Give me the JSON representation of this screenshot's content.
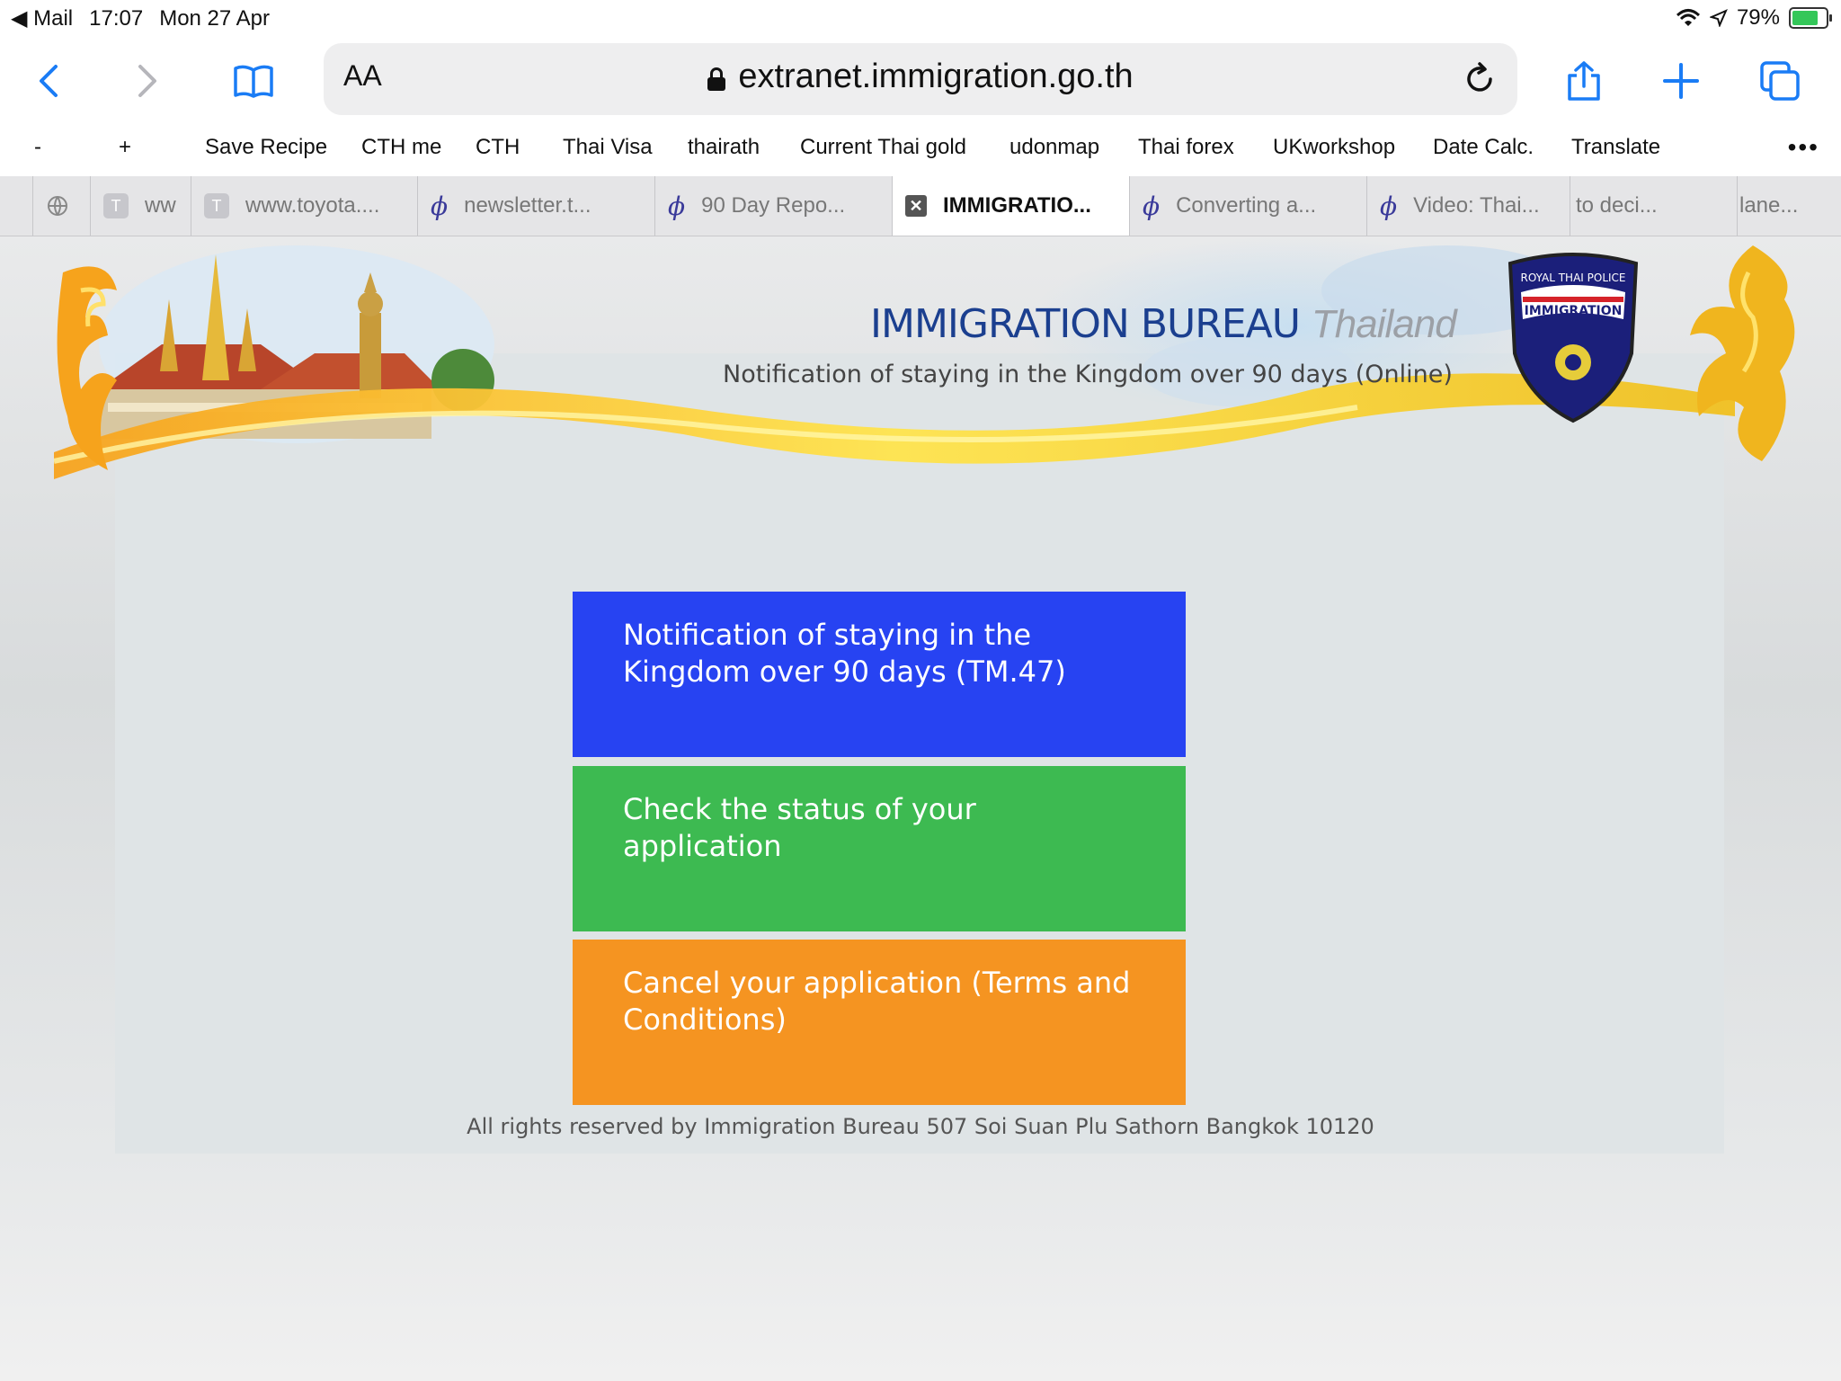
{
  "status_bar": {
    "back_app": "Mail",
    "time": "17:07",
    "date": "Mon 27 Apr",
    "battery": "79%"
  },
  "toolbar": {
    "text_size": "AA",
    "url": "extranet.immigration.go.th"
  },
  "favorites": [
    "-",
    "+",
    "Save Recipe",
    "CTH me",
    "CTH",
    "Thai Visa",
    "thairath",
    "Current Thai gold",
    "udonmap",
    "Thai forex",
    "UKworkshop",
    "Date Calc.",
    "Translate"
  ],
  "tabs": [
    {
      "title": "ww",
      "icon": "T"
    },
    {
      "title": "www.toyota....",
      "icon": "T"
    },
    {
      "title": "newsletter.t...",
      "icon": "phi"
    },
    {
      "title": "90 Day Repo...",
      "icon": "phi"
    },
    {
      "title": "IMMIGRATIO...",
      "icon": "close"
    },
    {
      "title": "Converting a...",
      "icon": "phi"
    },
    {
      "title": "Video: Thai...",
      "icon": "phi"
    },
    {
      "title": "to deci...",
      "icon": ""
    },
    {
      "title": "lane...",
      "icon": ""
    }
  ],
  "header": {
    "title_main": "IMMIGRATION BUREAU",
    "title_country": "Thailand",
    "subtitle": "Notification of staying in the Kingdom over 90 days (Online)",
    "badge_top": "ROYAL THAI POLICE",
    "badge_band": "IMMIGRATION"
  },
  "menu": {
    "notify": "Notification of staying in the Kingdom over 90 days (TM.47)",
    "status": "Check the status of your application",
    "cancel": "Cancel your application (Terms and Conditions)"
  },
  "footer": "All rights reserved by Immigration Bureau 507 Soi Suan Plu Sathorn Bangkok 10120",
  "colors": {
    "notify": "#2743f2",
    "status": "#3dba51",
    "cancel": "#f59421",
    "ios_blue": "#1a7cf5"
  }
}
